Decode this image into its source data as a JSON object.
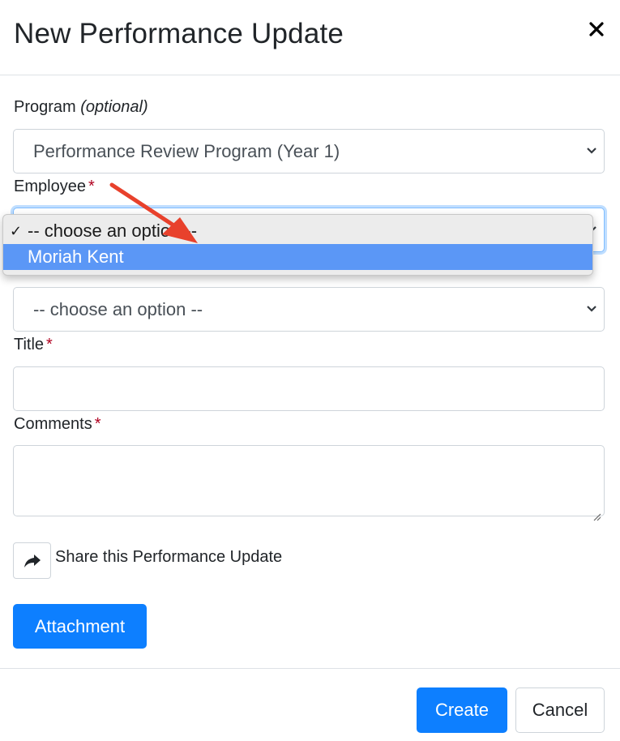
{
  "modal": {
    "title": "New Performance Update",
    "close_glyph": "✕"
  },
  "form": {
    "program": {
      "label": "Program",
      "optional_note": "(optional)",
      "selected": "Performance Review Program (Year 1)"
    },
    "employee": {
      "label": "Employee",
      "required_mark": "*",
      "dropdown_options": [
        {
          "label": "-- choose an option --",
          "checked": true,
          "highlighted": false
        },
        {
          "label": "Moriah Kent",
          "checked": false,
          "highlighted": true
        }
      ],
      "checkmark": "✓"
    },
    "type": {
      "selected": "-- choose an option --"
    },
    "title_field": {
      "label": "Title",
      "required_mark": "*",
      "value": ""
    },
    "comments": {
      "label": "Comments",
      "required_mark": "*",
      "value": ""
    },
    "share": {
      "label": "Share this Performance Update",
      "icon": "share-arrow-icon"
    },
    "attachment_button": "Attachment"
  },
  "footer": {
    "create_label": "Create",
    "cancel_label": "Cancel"
  },
  "colors": {
    "primary": "#0d7fff",
    "required": "#b00020",
    "highlight": "#5b97f6",
    "annotation_arrow": "#e8412c"
  }
}
